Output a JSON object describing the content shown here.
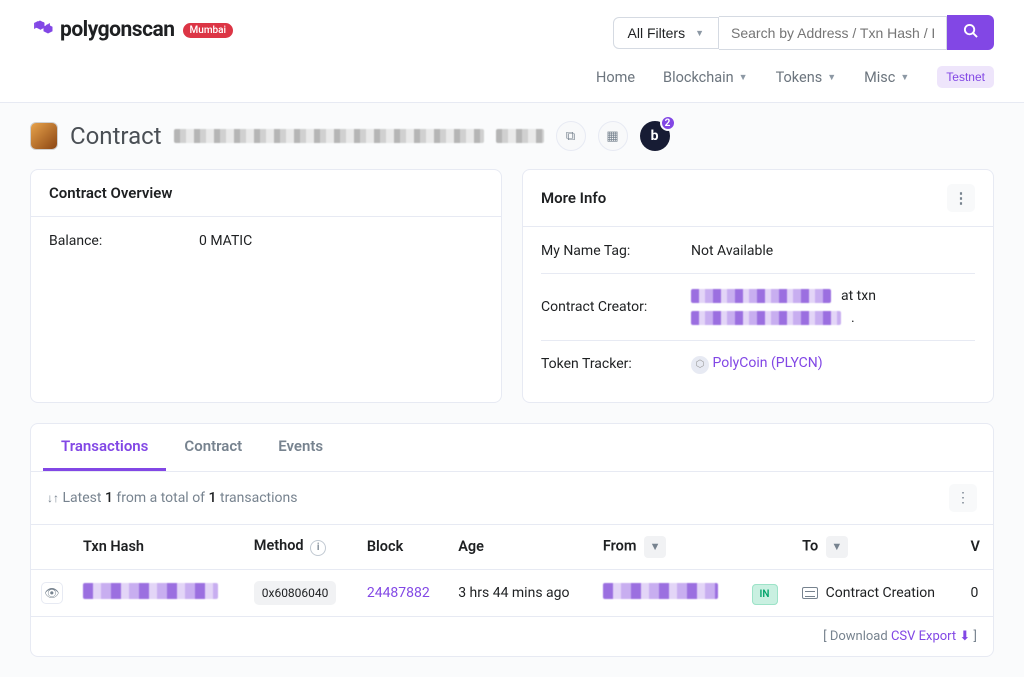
{
  "header": {
    "logo_text": "polygonscan",
    "badge": "Mumbai",
    "filter_label": "All Filters",
    "search_placeholder": "Search by Address / Txn Hash / Block",
    "nav": {
      "home": "Home",
      "blockchain": "Blockchain",
      "tokens": "Tokens",
      "misc": "Misc",
      "testnet": "Testnet"
    }
  },
  "title": {
    "label": "Contract",
    "b_badge": "2"
  },
  "overview": {
    "title": "Contract Overview",
    "balance_label": "Balance:",
    "balance_value": "0 MATIC"
  },
  "more_info": {
    "title": "More Info",
    "name_tag_label": "My Name Tag:",
    "name_tag_value": "Not Available",
    "creator_label": "Contract Creator:",
    "at_txn": "at txn",
    "period": ".",
    "tracker_label": "Token Tracker:",
    "tracker_value": "PolyCoin (PLYCN)"
  },
  "tabs": {
    "transactions": "Transactions",
    "contract": "Contract",
    "events": "Events"
  },
  "summary": {
    "prefix": "Latest",
    "count_shown": "1",
    "middle": "from a total of",
    "total": "1",
    "suffix": "transactions"
  },
  "table": {
    "headers": {
      "txn_hash": "Txn Hash",
      "method": "Method",
      "block": "Block",
      "age": "Age",
      "from": "From",
      "to": "To",
      "value": "V"
    },
    "row": {
      "method": "0x60806040",
      "block": "24487882",
      "age": "3 hrs 44 mins ago",
      "in_badge": "IN",
      "to": "Contract Creation",
      "value": "0"
    }
  },
  "csv": {
    "prefix": "[ Download",
    "link": "CSV Export",
    "suffix": "]"
  }
}
